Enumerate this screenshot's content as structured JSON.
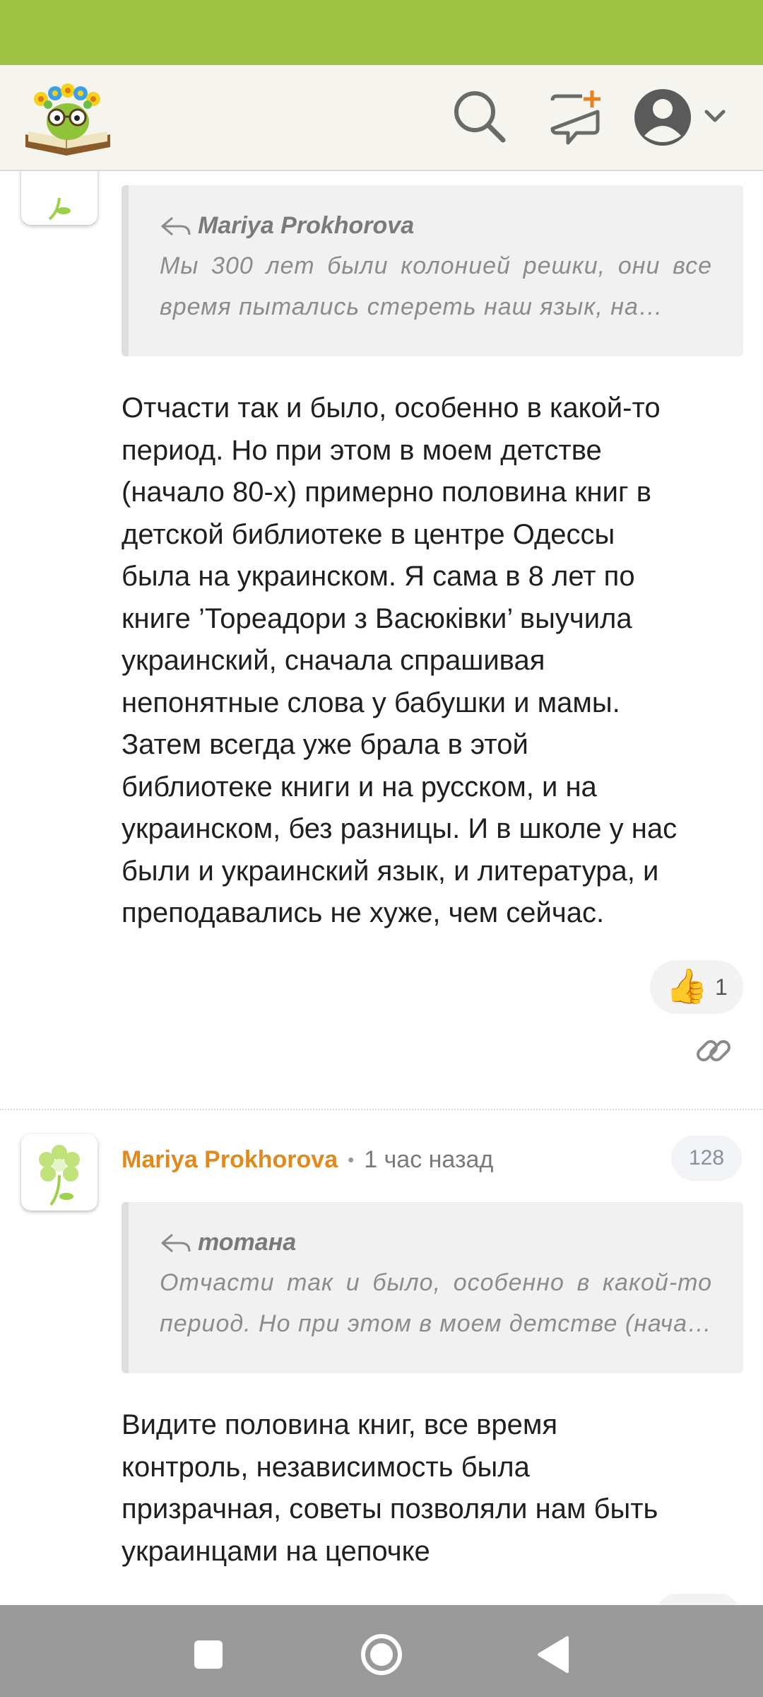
{
  "colors": {
    "status_bar": "#9dc244",
    "author_orange": "#e08a1e",
    "header_bg": "#f5f4ee"
  },
  "header": {
    "logo_icon": "book-flower-glasses-logo",
    "search_icon": "search-icon",
    "new_post_icon": "new-post-icon",
    "account_icon": "account-icon"
  },
  "comments": [
    {
      "quote": {
        "author": "Mariya Prokhorova",
        "lines": [
          "Мы 300 лет были колонией решки, они все",
          "время пытались стереть наш язык, на…"
        ]
      },
      "body_lines": [
        "Отчасти так и было, особенно в какой-то",
        "период. Но при этом в моем детстве",
        "(начало 80-х) примерно половина книг в",
        "детской библиотеке в центре Одессы",
        "была на украинском. Я сама в 8 лет по",
        "книге ’Тореадори з Васюківки’ выучила",
        "украинский, сначала спрашивая",
        "непонятные слова у бабушки и мамы.",
        "Затем всегда уже брала в этой",
        "библиотеке книги и на русском, и на",
        "украинском, без разницы. И в школе у нас",
        "были и украинский язык, и литература, и",
        "преподавались не хуже, чем сейчас."
      ],
      "like_emoji": "👍",
      "like_count": "1"
    },
    {
      "author": "Mariya Prokhorova",
      "separator": "•",
      "time": "1 час назад",
      "count": "128",
      "quote": {
        "author": "тотана",
        "lines": [
          "Отчасти так и было, особенно в какой-то",
          "период. Но при этом в моем детстве (нача…"
        ]
      },
      "body_lines": [
        "Видите половина книг, все время",
        "контроль, независимость была",
        "призрачная, советы позволяли нам быть",
        "украинцами на цепочке"
      ]
    }
  ],
  "nav": {
    "recents_icon": "square-icon",
    "home_icon": "circle-home-icon",
    "back_icon": "triangle-back-icon"
  }
}
